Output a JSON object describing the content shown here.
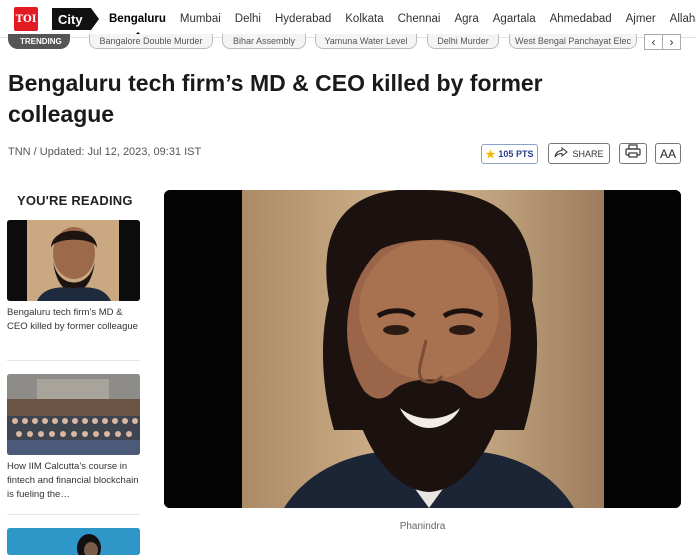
{
  "logo_text": "TOI",
  "city_tag": "City",
  "cities": [
    "Bengaluru",
    "Mumbai",
    "Delhi",
    "Hyderabad",
    "Kolkata",
    "Chennai",
    "Agra",
    "Agartala",
    "Ahmedabad",
    "Ajmer",
    "Allahabad"
  ],
  "trending": {
    "label": "TRENDING",
    "items": [
      "Bangalore Double Murder",
      "Bihar Assembly",
      "Yamuna Water Level",
      "Delhi Murder",
      "West Bengal Panchayat Elec"
    ]
  },
  "article": {
    "headline": "Bengaluru tech firm’s MD & CEO killed by former colleague",
    "byline": "TNN / Updated: Jul 12, 2023, 09:31 IST",
    "points": "105 PTS",
    "share_label": "SHARE",
    "font_label": "AA",
    "caption": "Phanindra"
  },
  "rail": {
    "title": "YOU'RE READING",
    "items": [
      {
        "text": "Bengaluru tech firm’s MD & CEO killed by former colleague"
      },
      {
        "text": "How IIM Calcutta’s course in fintech and financial blockchain is fueling the…"
      }
    ]
  },
  "colors": {
    "brand_red": "#e21b22",
    "accent_blue": "#2a3f8a",
    "star": "#f2b705"
  }
}
